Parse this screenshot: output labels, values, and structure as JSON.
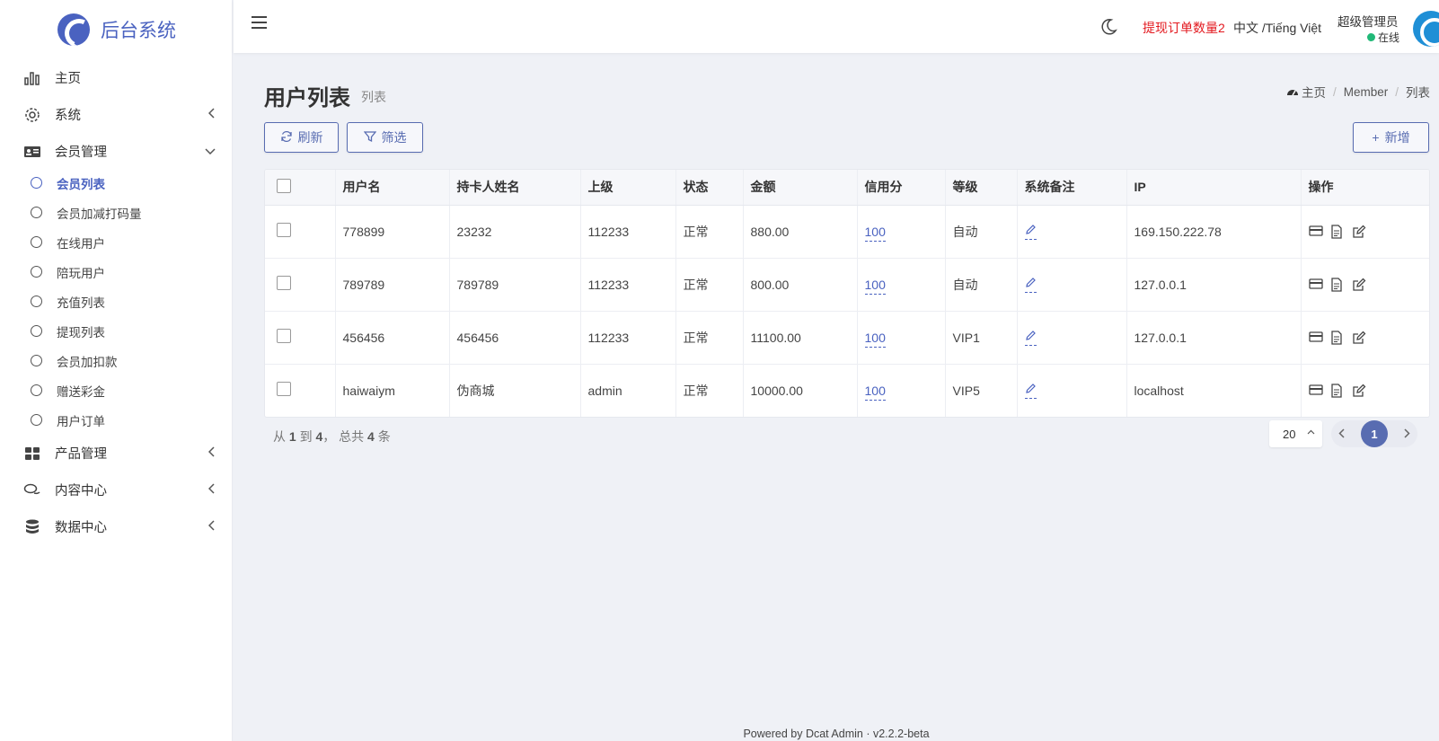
{
  "brand": {
    "name": "后台系统"
  },
  "sidebar": {
    "items": [
      {
        "label": "主页",
        "icon": "bar-chart-icon",
        "chevron": ""
      },
      {
        "label": "系统",
        "icon": "gear-icon",
        "chevron": "‹"
      },
      {
        "label": "会员管理",
        "icon": "id-card-icon",
        "chevron": "⌄"
      }
    ],
    "sub_items": [
      {
        "label": "会员列表",
        "active": true
      },
      {
        "label": "会员加减打码量"
      },
      {
        "label": "在线用户"
      },
      {
        "label": "陪玩用户"
      },
      {
        "label": "充值列表"
      },
      {
        "label": "提现列表"
      },
      {
        "label": "会员加扣款"
      },
      {
        "label": "赠送彩金"
      },
      {
        "label": "用户订单"
      }
    ],
    "items_after": [
      {
        "label": "产品管理",
        "icon": "grid-icon",
        "chevron": "‹"
      },
      {
        "label": "内容中心",
        "icon": "chat-icon",
        "chevron": "‹"
      },
      {
        "label": "数据中心",
        "icon": "database-icon",
        "chevron": "‹"
      }
    ]
  },
  "navbar": {
    "order_count": "提现订单数量2",
    "language": "中文 /Tiếng Việt",
    "user_name": "超级管理员",
    "user_status": "在线"
  },
  "page": {
    "title": "用户列表",
    "subtitle": "列表",
    "breadcrumb": [
      "主页",
      "Member",
      "列表"
    ]
  },
  "toolbar": {
    "refresh_label": "刷新",
    "filter_label": "筛选",
    "add_label": "新增"
  },
  "table": {
    "headers": [
      "用户名",
      "持卡人姓名",
      "上级",
      "状态",
      "金额",
      "信用分",
      "等级",
      "系统备注",
      "IP",
      "操作"
    ],
    "rows": [
      {
        "username": "778899",
        "holder": "23232",
        "parent": "112233",
        "status": "正常",
        "amount": "880.00",
        "credit": "100",
        "level": "自动",
        "ip": "169.150.222.78"
      },
      {
        "username": "789789",
        "holder": "789789",
        "parent": "112233",
        "status": "正常",
        "amount": "800.00",
        "credit": "100",
        "level": "自动",
        "ip": "127.0.0.1"
      },
      {
        "username": "456456",
        "holder": "456456",
        "parent": "112233",
        "status": "正常",
        "amount": "11100.00",
        "credit": "100",
        "level": "VIP1",
        "ip": "127.0.0.1"
      },
      {
        "username": "haiwaiym",
        "holder": "伪商城",
        "parent": "admin",
        "status": "正常",
        "amount": "10000.00",
        "credit": "100",
        "level": "VIP5",
        "ip": "localhost"
      }
    ]
  },
  "pagination": {
    "summary_prefix": "从",
    "from": "1",
    "to_word": "到",
    "to": "4",
    "total_word": "， 总共",
    "total": "4",
    "unit": "条",
    "page_size": "20",
    "current_page": "1"
  },
  "footer": {
    "powered": "Powered by Dcat Admin · v2.2.2-beta"
  },
  "colors": {
    "primary": "#586cb1",
    "brand": "#4a62c0",
    "alert": "#e3191f",
    "online": "#21b978"
  }
}
